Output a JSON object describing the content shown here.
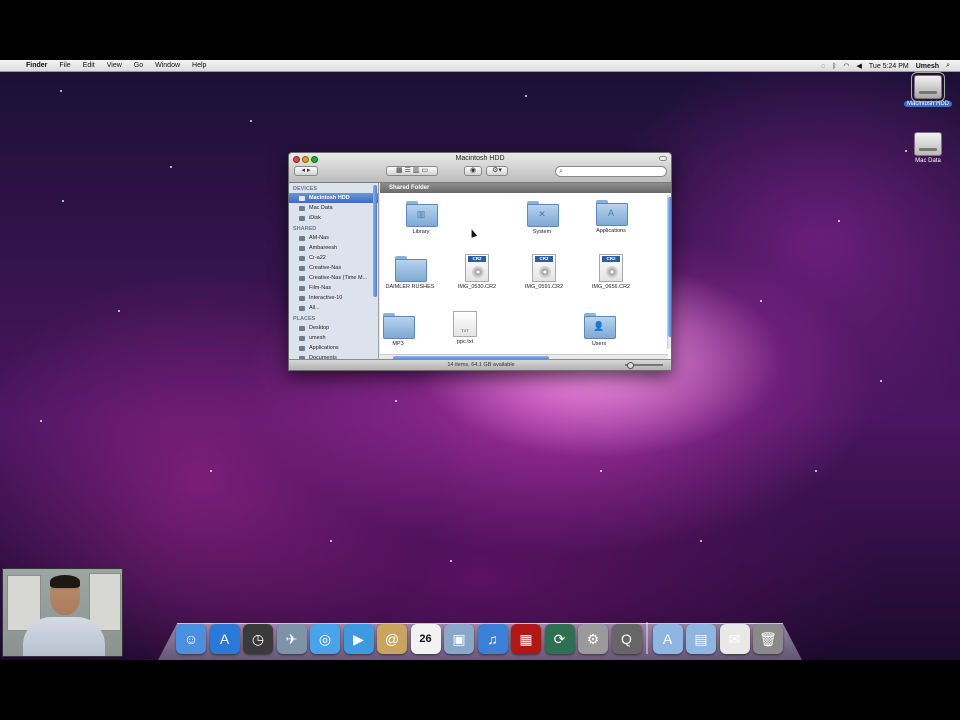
{
  "menubar": {
    "apple_glyph": "",
    "app_name": "Finder",
    "items": [
      "File",
      "Edit",
      "View",
      "Go",
      "Window",
      "Help"
    ],
    "clock": "Tue 5:24 PM",
    "user": "Umesh",
    "spotlight_glyph": "⌕"
  },
  "desktop_icons": [
    {
      "label": "Macintosh HDD",
      "icon": "hard-drive-icon",
      "selected": true
    },
    {
      "label": "Mac Data",
      "icon": "hard-drive-icon",
      "selected": false
    }
  ],
  "finder": {
    "title": "Macintosh HDD",
    "search_value": "",
    "path_label": "Shared Folder",
    "status": "14 items, 64.1 GB available",
    "sidebar": {
      "devices_header": "DEVICES",
      "devices": [
        "Macintosh HDD",
        "Mac Data",
        "iDisk"
      ],
      "shared_header": "SHARED",
      "shared": [
        "AM-Nas",
        "Ambareesh",
        "Cr-a22",
        "Creative-Nas",
        "Creative-Nas (Time M...",
        "Film-Nas",
        "Interactive-10",
        "All..."
      ],
      "places_header": "PLACES",
      "places": [
        "Desktop",
        "umesh",
        "Applications",
        "Documents"
      ]
    },
    "files": [
      {
        "name": "Library",
        "kind": "folder",
        "glyph": "▥"
      },
      {
        "name": "System",
        "kind": "folder",
        "glyph": "✕"
      },
      {
        "name": "Applications",
        "kind": "folder",
        "glyph": "A"
      },
      {
        "name": "DAIMLER RUSHES",
        "kind": "folder",
        "glyph": ""
      },
      {
        "name": "IMG_0530.CR2",
        "kind": "cr2",
        "badge": "CR2"
      },
      {
        "name": "IMG_0591.CR2",
        "kind": "cr2",
        "badge": "CR2"
      },
      {
        "name": "IMG_0656.CR2",
        "kind": "cr2",
        "badge": "CR2"
      },
      {
        "name": "MP3",
        "kind": "folder",
        "glyph": ""
      },
      {
        "name": "ppc.txt",
        "kind": "txt",
        "badge": "TXT"
      },
      {
        "name": "Users",
        "kind": "folder",
        "glyph": "👤"
      }
    ]
  },
  "dock": {
    "items": [
      {
        "name": "finder",
        "glyph": "☺",
        "color": "#4b8fe0"
      },
      {
        "name": "app-store",
        "glyph": "A",
        "color": "#2a78d8"
      },
      {
        "name": "dashboard",
        "glyph": "◷",
        "color": "#3a3a3a"
      },
      {
        "name": "mail",
        "glyph": "✈",
        "color": "#7e92a8"
      },
      {
        "name": "safari",
        "glyph": "◎",
        "color": "#4aa3e8"
      },
      {
        "name": "facetime",
        "glyph": "▶",
        "color": "#3d9ae0"
      },
      {
        "name": "address-book",
        "glyph": "@",
        "color": "#c8a45e"
      },
      {
        "name": "ical",
        "glyph": "26",
        "color": "#f2f2f2"
      },
      {
        "name": "preview",
        "glyph": "▣",
        "color": "#8aa6c8"
      },
      {
        "name": "itunes",
        "glyph": "♫",
        "color": "#3b7fd6"
      },
      {
        "name": "photo-booth",
        "glyph": "▦",
        "color": "#b01818"
      },
      {
        "name": "time-machine",
        "glyph": "⟳",
        "color": "#2f6f52"
      },
      {
        "name": "system-preferences",
        "glyph": "⚙",
        "color": "#9a9a9a"
      },
      {
        "name": "quicktime",
        "glyph": "Q",
        "color": "#666"
      }
    ],
    "stacks": [
      {
        "name": "applications-stack",
        "glyph": "A",
        "color": "#8fb6e0"
      },
      {
        "name": "documents-stack",
        "glyph": "▤",
        "color": "#8fb6e0"
      },
      {
        "name": "downloads-stack",
        "glyph": "✉",
        "color": "#e8e8e8"
      },
      {
        "name": "trash",
        "glyph": "🗑",
        "color": "#8a8a8a"
      }
    ],
    "ical_day": "26"
  }
}
